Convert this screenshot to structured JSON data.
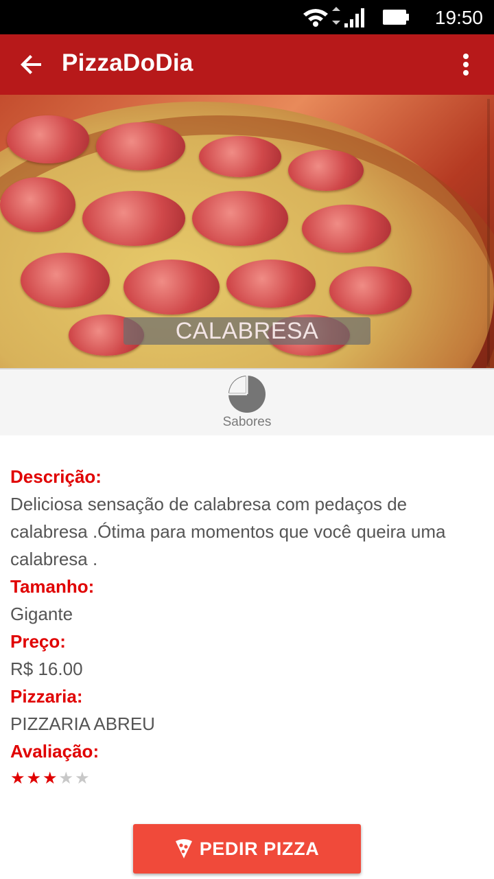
{
  "status_bar": {
    "time": "19:50",
    "icons": [
      "wifi-icon",
      "signal-icon",
      "battery-icon"
    ]
  },
  "app_bar": {
    "title": "PizzaDoDia",
    "back_icon": "arrow-left-icon",
    "menu_icon": "more-vert-icon",
    "color": "#b7191a"
  },
  "hero": {
    "pizza_name": "CALABRESA"
  },
  "sabores": {
    "label": "Sabores",
    "icon": "pie-chart-icon"
  },
  "details": {
    "descricao_label": "Descrição:",
    "descricao_value": "Deliciosa sensação de calabresa com pedaços de calabresa .Ótima para momentos que você queira uma calabresa .",
    "tamanho_label": "Tamanho:",
    "tamanho_value": "Gigante",
    "preco_label": "Preço:",
    "preco_value": "R$ 16.00",
    "pizzaria_label": "Pizzaria:",
    "pizzaria_value": "PIZZARIA ABREU",
    "avaliacao_label": "Avaliação:",
    "avaliacao_value": 3,
    "avaliacao_max": 5,
    "label_color": "#e00000"
  },
  "order_button": {
    "label": "PEDIR PIZZA",
    "icon": "pizza-slice-icon",
    "color": "#f04a3a"
  }
}
